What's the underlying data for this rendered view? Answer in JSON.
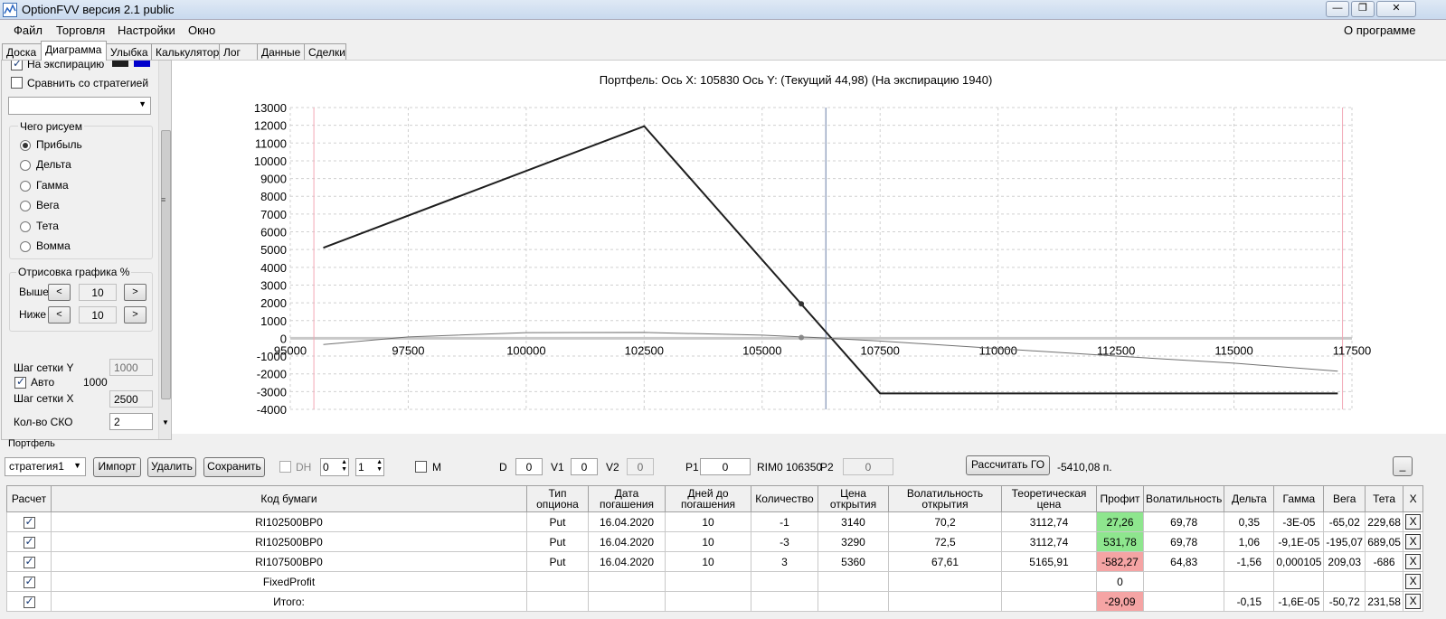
{
  "window": {
    "title": "OptionFVV версия 2.1 public"
  },
  "menu": {
    "items": [
      "Файл",
      "Торговля",
      "Настройки",
      "Окно"
    ],
    "about": "О программе"
  },
  "tabs": [
    "Доска",
    "Диаграмма",
    "Улыбка",
    "Калькулятор",
    "Лог",
    "Данные",
    "Сделки"
  ],
  "left": {
    "expiry_label": "На экспирацию",
    "compare_label": "Сравнить со стратегией",
    "what_title": "Чего рисуем",
    "radios": [
      "Прибыль",
      "Дельта",
      "Гамма",
      "Вега",
      "Тета",
      "Вомма"
    ],
    "render_title": "Отрисовка графика %",
    "above_label": "Выше",
    "above_value": "10",
    "below_label": "Ниже",
    "below_value": "10",
    "grid_y_label": "Шаг сетки Y",
    "grid_y_value": "1000",
    "auto_label": "Авто",
    "auto_value": "1000",
    "grid_x_label": "Шаг сетки X",
    "grid_x_value": "2500",
    "sko_label": "Кол-во СКО",
    "sko_value": "2"
  },
  "colors": {
    "swatch_current": "#1e1e1e",
    "swatch_expiry": "#0000cc",
    "profit_pos": "#8ee68e",
    "profit_neg": "#f5a4a4"
  },
  "chart_data": {
    "type": "line",
    "title": "Портфель: Ось X: 105830 Ось Y:  (Текущий 44,98)  (На экспирацию 1940)",
    "xlim": [
      95000,
      117500
    ],
    "ylim": [
      -4000,
      13000
    ],
    "x_ticks": [
      "95000",
      "97500",
      "100000",
      "102500",
      "105000",
      "107500",
      "110000",
      "112500",
      "115000",
      "117500"
    ],
    "y_ticks": [
      "13000",
      "12000",
      "11000",
      "10000",
      "9000",
      "8000",
      "7000",
      "6000",
      "5000",
      "4000",
      "3000",
      "2000",
      "1000",
      "0",
      "-1000",
      "-2000",
      "-3000",
      "-4000"
    ],
    "grid": true,
    "series": [
      {
        "color": "#1e1e1e",
        "width": 2,
        "points": [
          [
            95700,
            5100
          ],
          [
            102500,
            11950
          ],
          [
            107500,
            -3100
          ],
          [
            117200,
            -3100
          ]
        ]
      },
      {
        "color": "#707070",
        "width": 1,
        "points": [
          [
            95700,
            -350
          ],
          [
            97500,
            80
          ],
          [
            100000,
            320
          ],
          [
            102500,
            330
          ],
          [
            105000,
            180
          ],
          [
            106000,
            60
          ],
          [
            107500,
            -150
          ],
          [
            110000,
            -580
          ],
          [
            112500,
            -1000
          ],
          [
            115000,
            -1400
          ],
          [
            117200,
            -1850
          ]
        ]
      }
    ],
    "markers": [
      [
        105830,
        1940
      ],
      [
        105830,
        45
      ]
    ],
    "current_x": 106350,
    "bound_lines": [
      95500,
      117300
    ]
  },
  "portfolio": {
    "label": "Портфель",
    "strategy": "стратегия1",
    "import": "Импорт",
    "delete": "Удалить",
    "save": "Сохранить",
    "dh": "DH",
    "spin1": "0",
    "spin2": "1",
    "m": "M",
    "d_label": "D",
    "d": "0",
    "v1_label": "V1",
    "v1": "0",
    "v2_label": "V2",
    "v2": "0",
    "p1_label": "P1",
    "p1": "0",
    "rim": "RIM0 106350",
    "p2_label": "P2",
    "p2": "0",
    "calc_go": "Рассчитать ГО",
    "go_value": "-5410,08 п.",
    "minimize": "_"
  },
  "table": {
    "headers": [
      "Расчет",
      "Код бумаги",
      "Тип опциона",
      "Дата погашения",
      "Дней до погашения",
      "Количество",
      "Цена открытия",
      "Волатильность открытия",
      "Теоретическая цена",
      "Профит",
      "Волатильность",
      "Дельта",
      "Гамма",
      "Вега",
      "Тета",
      "X"
    ],
    "rows": [
      [
        "RI102500BP0",
        "Put",
        "16.04.2020",
        "10",
        "-1",
        "3140",
        "70,2",
        "3112,74",
        "27,26",
        "69,78",
        "0,35",
        "-3E-05",
        "-65,02",
        "229,68"
      ],
      [
        "RI102500BP0",
        "Put",
        "16.04.2020",
        "10",
        "-3",
        "3290",
        "72,5",
        "3112,74",
        "531,78",
        "69,78",
        "1,06",
        "-9,1E-05",
        "-195,07",
        "689,05"
      ],
      [
        "RI107500BP0",
        "Put",
        "16.04.2020",
        "10",
        "3",
        "5360",
        "67,61",
        "5165,91",
        "-582,27",
        "64,83",
        "-1,56",
        "0,000105",
        "209,03",
        "-686"
      ],
      [
        "FixedProfit",
        "",
        "",
        "",
        "",
        "",
        "",
        "",
        "0",
        "",
        "",
        "",
        "",
        ""
      ],
      [
        "Итого:",
        "",
        "",
        "",
        "",
        "",
        "",
        "",
        "-29,09",
        "",
        "-0,15",
        "-1,6E-05",
        "-50,72",
        "231,58"
      ]
    ],
    "profit_sign": [
      "pos",
      "pos",
      "neg",
      "",
      "neg"
    ],
    "xmark": "X"
  }
}
